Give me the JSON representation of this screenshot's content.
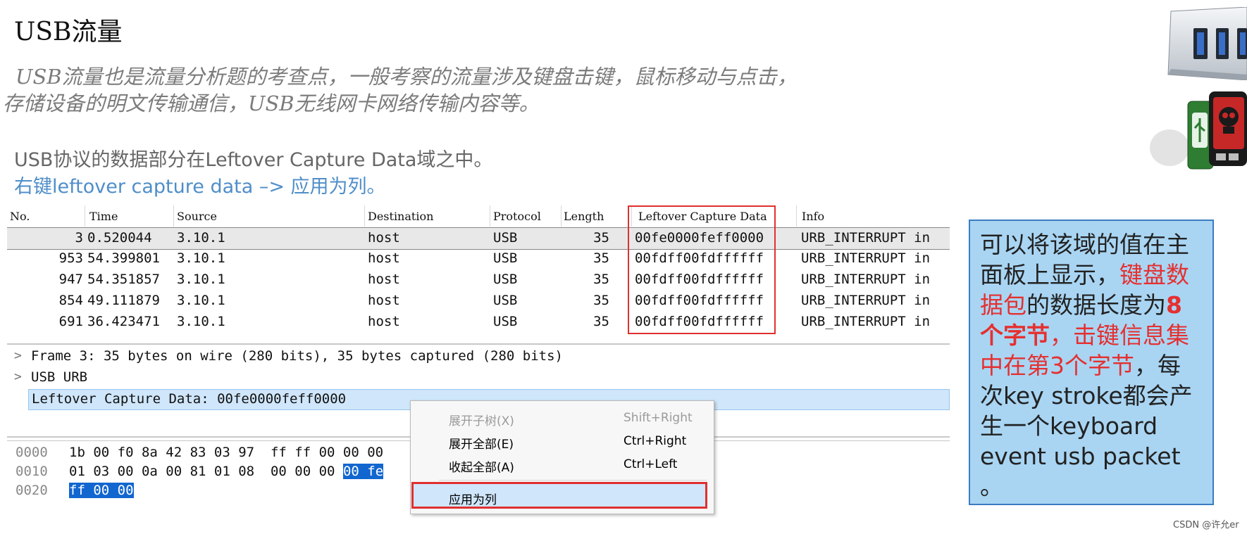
{
  "title": "USB流量",
  "intro": {
    "line1": "USB流量也是流量分析题的考查点，一般考察的流量涉及键盘击键，鼠标移动与点击，",
    "line2": "存储设备的明文传输通信，USB无线网卡网络传输内容等。"
  },
  "notes": {
    "line1": "USB协议的数据部分在Leftover Capture Data域之中。",
    "line2": "右键leftover capture data –> 应用为列。"
  },
  "packet_list": {
    "columns": [
      "No.",
      "Time",
      "Source",
      "Destination",
      "Protocol",
      "Length",
      "Leftover Capture Data",
      "Info"
    ],
    "rows": [
      {
        "no": "3",
        "time": "0.520044",
        "source": "3.10.1",
        "destination": "host",
        "protocol": "USB",
        "length": "35",
        "data": "00fe0000feff0000",
        "info": "URB_INTERRUPT in"
      },
      {
        "no": "953",
        "time": "54.399801",
        "source": "3.10.1",
        "destination": "host",
        "protocol": "USB",
        "length": "35",
        "data": "00fdff00fdffffff",
        "info": "URB_INTERRUPT in"
      },
      {
        "no": "947",
        "time": "54.351857",
        "source": "3.10.1",
        "destination": "host",
        "protocol": "USB",
        "length": "35",
        "data": "00fdff00fdffffff",
        "info": "URB_INTERRUPT in"
      },
      {
        "no": "854",
        "time": "49.111879",
        "source": "3.10.1",
        "destination": "host",
        "protocol": "USB",
        "length": "35",
        "data": "00fdff00fdffffff",
        "info": "URB_INTERRUPT in"
      },
      {
        "no": "691",
        "time": "36.423471",
        "source": "3.10.1",
        "destination": "host",
        "protocol": "USB",
        "length": "35",
        "data": "00fdff00fdffffff",
        "info": "URB_INTERRUPT in"
      }
    ]
  },
  "detail_tree": {
    "frame": "Frame 3: 35 bytes on wire (280 bits), 35 bytes captured (280 bits)",
    "usb_urb": "USB URB",
    "leftover": "Leftover Capture Data: 00fe0000feff0000",
    "expander_glyph": ">"
  },
  "hex_dump": [
    {
      "offset": "0000",
      "bytes": "1b 00 f0 8a 42 83 03 97  ff ff 00 00 00",
      "highlight": ""
    },
    {
      "offset": "0010",
      "bytes": "01 03 00 0a 00 81 01 08  00 00 00 ",
      "highlight": "00 fe"
    },
    {
      "offset": "0020",
      "bytes": "",
      "highlight": "ff 00 00"
    }
  ],
  "context_menu": {
    "items": [
      {
        "label": "展开子树(X)",
        "shortcut": "Shift+Right",
        "disabled": true
      },
      {
        "label": "展开全部(E)",
        "shortcut": "Ctrl+Right",
        "disabled": false
      },
      {
        "label": "收起全部(A)",
        "shortcut": "Ctrl+Left",
        "disabled": false
      }
    ],
    "apply_as_column": "应用为列"
  },
  "callout": {
    "p1": "可以将该域的值在主面板上显示，",
    "p2": "键盘数据包",
    "p3": "的数据长度为",
    "p4": "8个字节",
    "p5": "，",
    "p6": "击键信息集中在第3个字节",
    "p7": "，每次key stroke都会产生一个keyboard event usb packet 。"
  },
  "watermark": "CSDN @许允er",
  "colors": {
    "accent_red": "#e03030",
    "note_blue": "#4f8ec9",
    "callout_bg": "#a9d5f3",
    "selection": "#cfe6fb"
  }
}
